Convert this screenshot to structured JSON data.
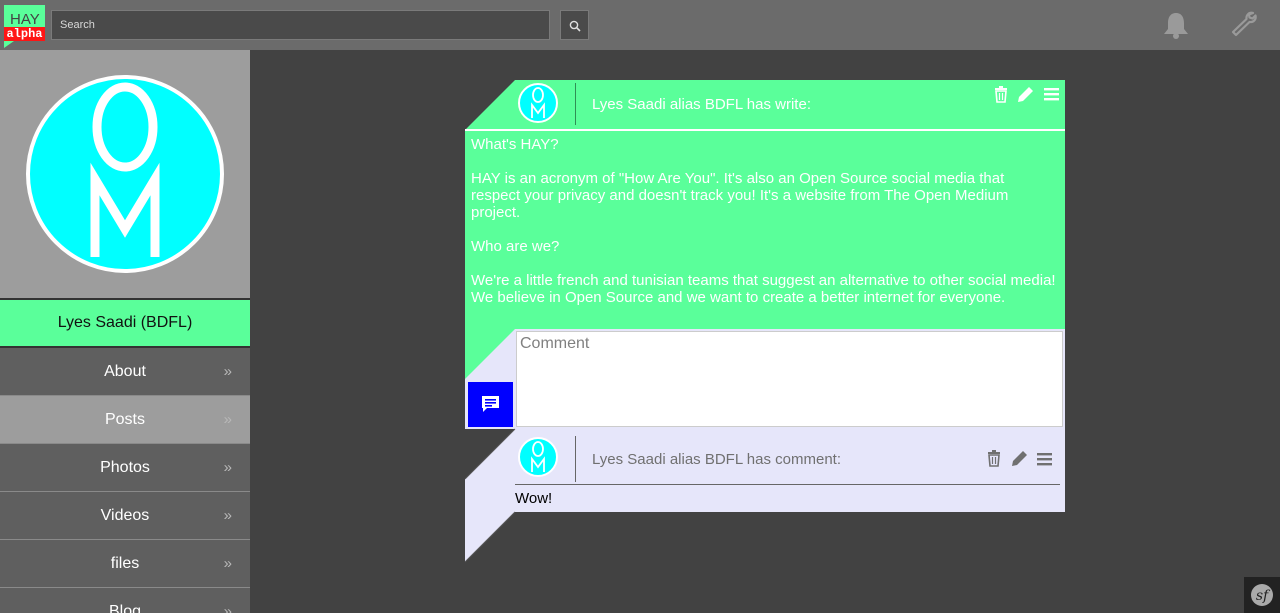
{
  "app": {
    "logo_text": "HAY",
    "logo_badge": "alpha"
  },
  "search": {
    "placeholder": "Search"
  },
  "icons": {
    "search": "search-icon",
    "notifications": "bell-icon",
    "settings": "wrench-icon",
    "comment_submit": "chat-bubble-icon",
    "delete": "trash-icon",
    "edit": "pencil-icon",
    "menu": "hamburger-icon",
    "footer_badge": "symfony-icon"
  },
  "profile": {
    "display_name": "Lyes Saadi (BDFL)"
  },
  "nav": {
    "items": [
      {
        "label": "About",
        "active": false
      },
      {
        "label": "Posts",
        "active": true
      },
      {
        "label": "Photos",
        "active": false
      },
      {
        "label": "Videos",
        "active": false
      },
      {
        "label": "files",
        "active": false
      },
      {
        "label": "Blog",
        "active": false
      }
    ]
  },
  "post": {
    "header": "Lyes Saadi alias BDFL has write:",
    "paragraphs": [
      "What's HAY?",
      "HAY is an acronym of \"How Are You\". It's also an Open Source social media that respect your privacy and doesn't track you! It's a website from The Open Medium project.",
      "Who are we?",
      "We're a little french and tunisian teams that suggest an alternative to other social media! We believe in Open Source and we want to create a better internet for everyone."
    ],
    "comment_placeholder": "Comment"
  },
  "comment": {
    "header": "Lyes Saadi alias BDFL has comment:",
    "text": "Wow!"
  },
  "colors": {
    "accent_green": "#5aff9a",
    "avatar_cyan": "#00ffff",
    "comment_bg": "#e6e6fa",
    "submit_blue": "#0000ff",
    "logo_red": "#ff1515",
    "page_bg": "#424242",
    "topbar_bg": "#6b6b6b"
  }
}
